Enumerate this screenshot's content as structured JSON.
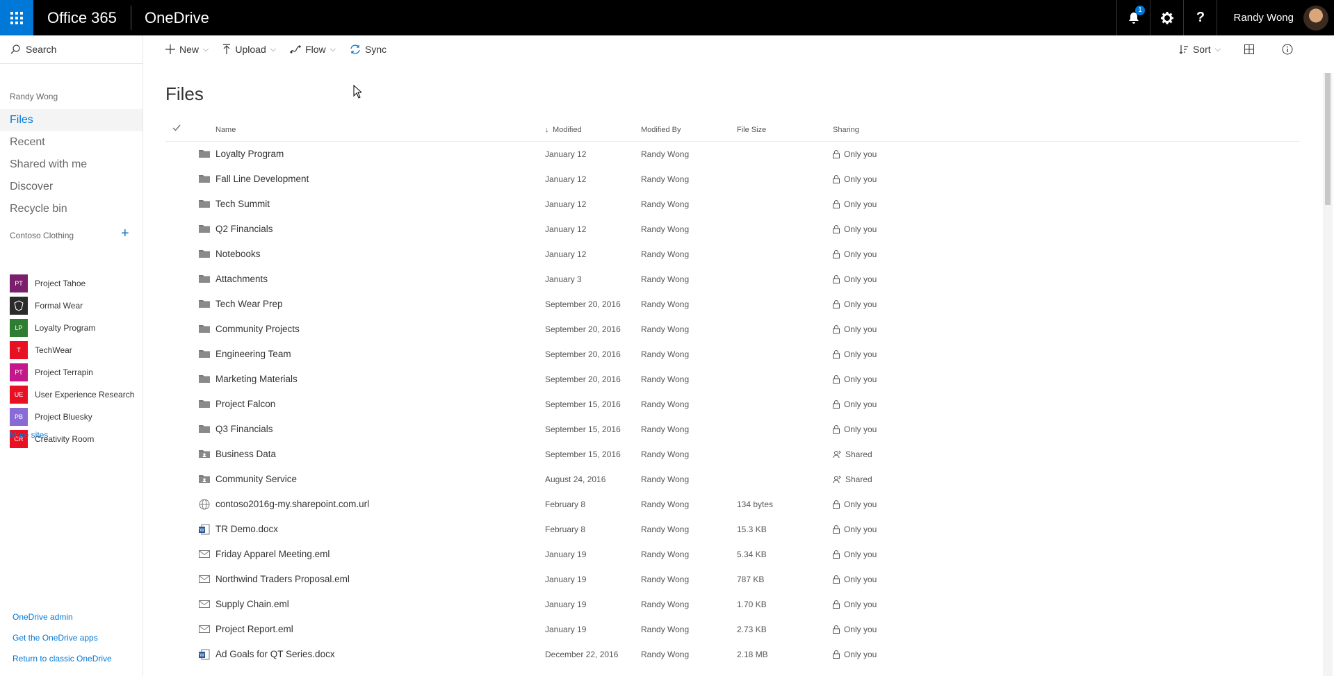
{
  "topbar": {
    "brand": "Office 365",
    "app": "OneDrive",
    "notifications_count": "1",
    "help_label": "?",
    "user_name": "Randy Wong",
    "icons": [
      "waffle-icon",
      "bell-icon",
      "gear-icon",
      "help-icon"
    ]
  },
  "sidebar": {
    "search_label": "Search",
    "user_label": "Randy Wong",
    "nav": [
      "Files",
      "Recent",
      "Shared with me",
      "Discover",
      "Recycle bin"
    ],
    "active_nav": "Files",
    "group_title": "Contoso Clothing",
    "group_add": "+",
    "sites": [
      {
        "abbr": "PT",
        "name": "Project Tahoe",
        "color": "#7a1f6b"
      },
      {
        "abbr": "",
        "name": "Formal Wear",
        "color": "#2b2b2b"
      },
      {
        "abbr": "LP",
        "name": "Loyalty Program",
        "color": "#2e7d32"
      },
      {
        "abbr": "T",
        "name": "TechWear",
        "color": "#e81123"
      },
      {
        "abbr": "PT",
        "name": "Project Terrapin",
        "color": "#c2188a"
      },
      {
        "abbr": "UE",
        "name": "User Experience Research",
        "color": "#e81123"
      },
      {
        "abbr": "PB",
        "name": "Project Bluesky",
        "color": "#8a6bd6"
      },
      {
        "abbr": "CR",
        "name": "Creativity Room",
        "color": "#e81123"
      }
    ],
    "more_sites": "More sites",
    "footer_links": [
      "OneDrive admin",
      "Get the OneDrive apps",
      "Return to classic OneDrive"
    ]
  },
  "commandbar": {
    "new": "New",
    "upload": "Upload",
    "flow": "Flow",
    "sync": "Sync",
    "sort": "Sort"
  },
  "main": {
    "title": "Files",
    "columns": {
      "name": "Name",
      "modified": "Modified",
      "modified_by": "Modified By",
      "file_size": "File Size",
      "sharing": "Sharing"
    },
    "rows": [
      {
        "type": "folder",
        "name": "Loyalty Program",
        "modified": "January 12",
        "by": "Randy Wong",
        "size": "",
        "sharing": "Only you"
      },
      {
        "type": "folder",
        "name": "Fall Line Development",
        "modified": "January 12",
        "by": "Randy Wong",
        "size": "",
        "sharing": "Only you"
      },
      {
        "type": "folder",
        "name": "Tech Summit",
        "modified": "January 12",
        "by": "Randy Wong",
        "size": "",
        "sharing": "Only you"
      },
      {
        "type": "folder",
        "name": "Q2 Financials",
        "modified": "January 12",
        "by": "Randy Wong",
        "size": "",
        "sharing": "Only you"
      },
      {
        "type": "folder",
        "name": "Notebooks",
        "modified": "January 12",
        "by": "Randy Wong",
        "size": "",
        "sharing": "Only you"
      },
      {
        "type": "folder",
        "name": "Attachments",
        "modified": "January 3",
        "by": "Randy Wong",
        "size": "",
        "sharing": "Only you"
      },
      {
        "type": "folder",
        "name": "Tech Wear Prep",
        "modified": "September 20, 2016",
        "by": "Randy Wong",
        "size": "",
        "sharing": "Only you"
      },
      {
        "type": "folder",
        "name": "Community Projects",
        "modified": "September 20, 2016",
        "by": "Randy Wong",
        "size": "",
        "sharing": "Only you"
      },
      {
        "type": "folder",
        "name": "Engineering Team",
        "modified": "September 20, 2016",
        "by": "Randy Wong",
        "size": "",
        "sharing": "Only you"
      },
      {
        "type": "folder",
        "name": "Marketing Materials",
        "modified": "September 20, 2016",
        "by": "Randy Wong",
        "size": "",
        "sharing": "Only you"
      },
      {
        "type": "folder",
        "name": "Project Falcon",
        "modified": "September 15, 2016",
        "by": "Randy Wong",
        "size": "",
        "sharing": "Only you"
      },
      {
        "type": "folder",
        "name": "Q3 Financials",
        "modified": "September 15, 2016",
        "by": "Randy Wong",
        "size": "",
        "sharing": "Only you"
      },
      {
        "type": "folder-shared",
        "name": "Business Data",
        "modified": "September 15, 2016",
        "by": "Randy Wong",
        "size": "",
        "sharing": "Shared"
      },
      {
        "type": "folder-shared",
        "name": "Community Service",
        "modified": "August 24, 2016",
        "by": "Randy Wong",
        "size": "",
        "sharing": "Shared"
      },
      {
        "type": "url",
        "name": "contoso2016g-my.sharepoint.com.url",
        "modified": "February 8",
        "by": "Randy Wong",
        "size": "134 bytes",
        "sharing": "Only you"
      },
      {
        "type": "docx",
        "name": "TR Demo.docx",
        "modified": "February 8",
        "by": "Randy Wong",
        "size": "15.3 KB",
        "sharing": "Only you"
      },
      {
        "type": "eml",
        "name": "Friday Apparel Meeting.eml",
        "modified": "January 19",
        "by": "Randy Wong",
        "size": "5.34 KB",
        "sharing": "Only you"
      },
      {
        "type": "eml",
        "name": "Northwind Traders Proposal.eml",
        "modified": "January 19",
        "by": "Randy Wong",
        "size": "787 KB",
        "sharing": "Only you"
      },
      {
        "type": "eml",
        "name": "Supply Chain.eml",
        "modified": "January 19",
        "by": "Randy Wong",
        "size": "1.70 KB",
        "sharing": "Only you"
      },
      {
        "type": "eml",
        "name": "Project Report.eml",
        "modified": "January 19",
        "by": "Randy Wong",
        "size": "2.73 KB",
        "sharing": "Only you"
      },
      {
        "type": "docx",
        "name": "Ad Goals for QT Series.docx",
        "modified": "December 22, 2016",
        "by": "Randy Wong",
        "size": "2.18 MB",
        "sharing": "Only you"
      }
    ]
  }
}
